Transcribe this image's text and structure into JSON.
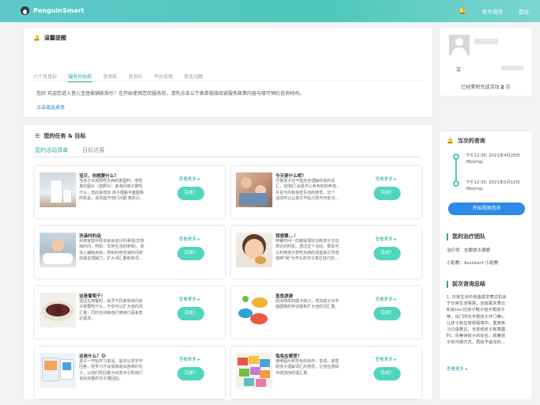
{
  "header": {
    "brand": "PenguinSmart",
    "account_label": "账号资讯",
    "logout_label": "登出"
  },
  "notice": {
    "title": "温馨提醒",
    "tabs": [
      "六个月目标",
      "服务开始前",
      "咨询前",
      "咨询中",
      "平台说明",
      "常见问题"
    ],
    "active_tab": 1,
    "text": "您好 欢迎您进入皆儿宝居家辅练指引！在开始使用您的服务前，请先点击以下表单链接阅读服务政策内容与填写预约咨询时间。",
    "link": "点击填选表单"
  },
  "profile": {
    "name_prefix": "文",
    "status_prefix": "已经累积完成活动",
    "count": "2",
    "count_unit": "次"
  },
  "tasks": {
    "title": "您的任务 & 目标",
    "tabs": [
      "您的活动清单",
      "目标进展"
    ],
    "more_label": "查看更多",
    "done_label": "完成？",
    "items": [
      {
        "title": "宝贝，你想要什么？",
        "desc": "当孩子出现想吃东西的意图时，用告\n真的图片（如照片）来询问孩子要吃\n什么，借此来增加 孩子理解平面图像\n的机会，进而提升他们对图 像的兴..."
      },
      {
        "title": "今天穿什么呢？",
        "desc": "尽量孩子还不能完全理解你说的词\n汇，但他们 会很开心听到你的声音，\n并且与你有亲密互动的感觉。这个\n活动可以让孩子开始习惯与你有沟..."
      },
      {
        "title": "洗澡时的话",
        "desc": "利用家庭中原本就会进行的事情(非游\n戏时间，例如：日常生活的常规)，来\n加入辅练目标，例如利用洗澡时间增\n加语言理解力，扩大词汇量和单词..."
      },
      {
        "title": "我想要...！",
        "desc": "用餐时间一向都是很好训练孩子主动\n表达的时机，透过这个活动，要去可\n以利用孩子想吃东西的渴望来引导他\n使用\"我\"为开头的句子表达自己的..."
      },
      {
        "title": "这是葡萄干！",
        "desc": "透过在用餐时，给予不同食物询问孩\n子想要吃什么，不仅可以扩大他的词\n汇量，同时也训练他们使用口语来表\n达需求。"
      },
      {
        "title": "鱼鱼游游",
        "desc": "经由简单的图卡练习，增加孩子对平\n面图像的辨识度和扩大他的词汇量。"
      },
      {
        "title": "这是什么？🐵",
        "desc": "孩子一开始学习说话，是仅以单字作\n回答，经学习才会渐渐说出连续的句\n子，以他们所回答为出发点引导他们\n说出完整的句子描回应。"
      },
      {
        "title": "兔兔在哪里？",
        "desc": "使用图片和夸张的动作，音调，来帮\n助孩子理解词汇的意思，让他在游戏\n中增加他的语汇量。"
      }
    ]
  },
  "next_session": {
    "title": "当次的咨询",
    "sessions": [
      {
        "time": "下午12:30, 2021年4月28日",
        "tz": "(Beijing)"
      },
      {
        "time": "下午12:30, 2021年5月12日",
        "tz": "(Beijing)"
      }
    ],
    "video_button": "开始视频咨询",
    "team_title": "您的治疗团队",
    "therapist": "治疗师：吉娜提古德娜",
    "assistant": "小助教：Assistant 小助教",
    "summary_title": "前次咨询总结",
    "summary": "1. 日常生活中创造需求表达机会\n于日常生活情境，创造需求表达\n机会(ex:拉孩子鞋子但不帮孩子\n穿，出门时先不帮孩子开门等)，\n让孩子能在常规情境中，重复练\n习口语表达，当发现孩子有意图\n时，先等待孩子的反应，观察孩\n子的沟通方式，再给予适当的...",
    "more_label": "查看更多"
  },
  "colors": {
    "accent": "#4cc7b9",
    "button": "#4fd6bd",
    "video_button": "#2d8ae6",
    "link": "#2b7fd4"
  },
  "icons": {
    "bell": "bell-icon",
    "list": "list-icon",
    "chevron": "chevron-right-icon"
  }
}
